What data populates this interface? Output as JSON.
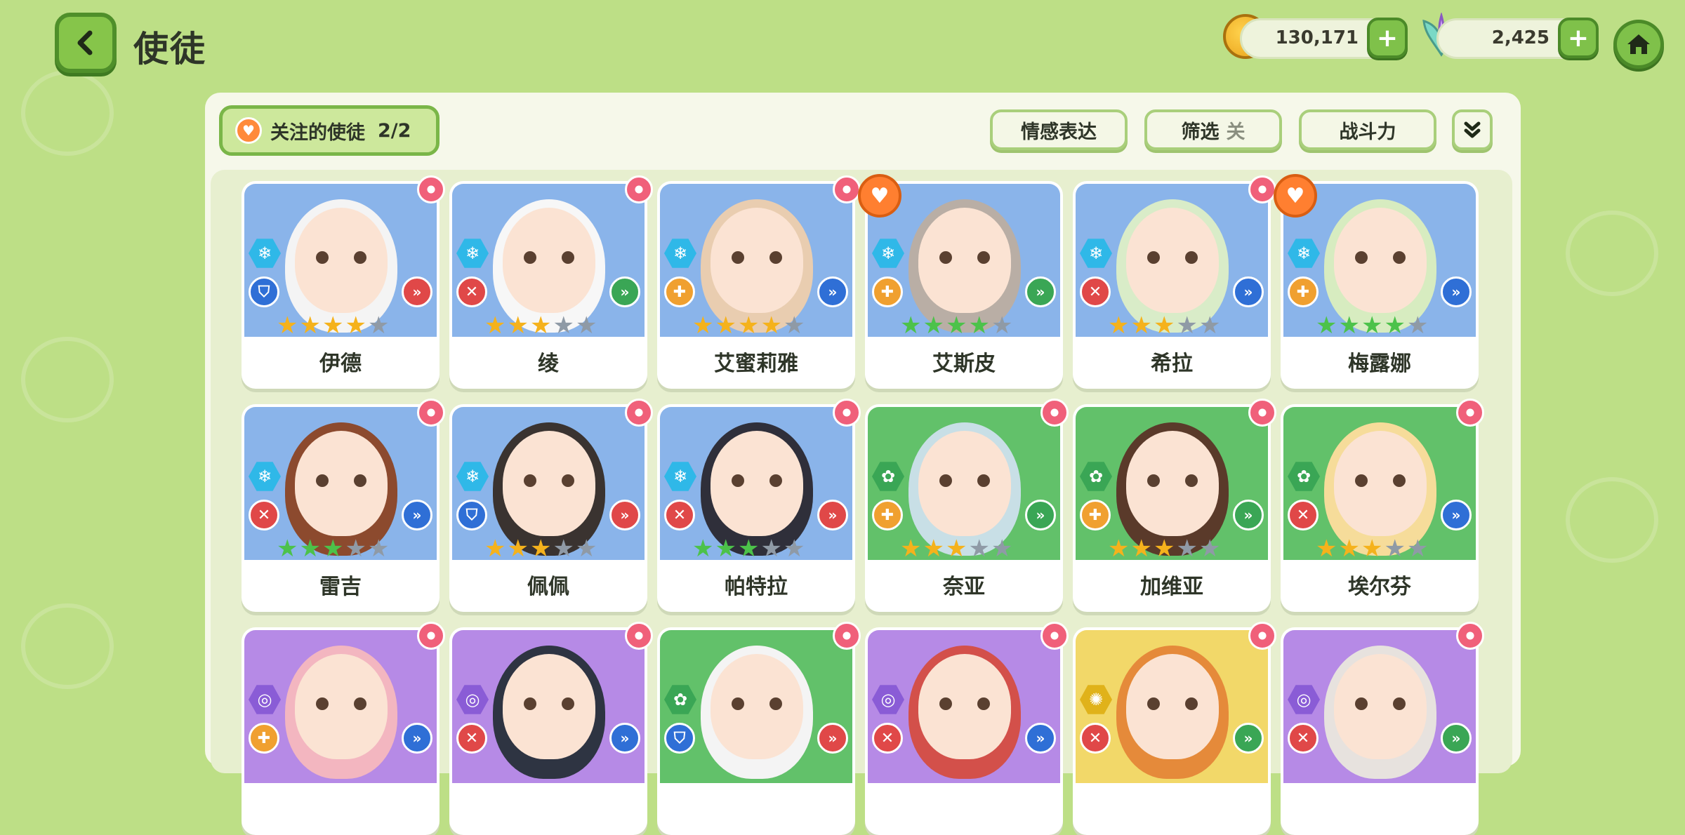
{
  "header": {
    "title": "使徒",
    "gold": "130,171",
    "gems": "2,425"
  },
  "toolbar": {
    "follow_label": "关注的使徒",
    "follow_count": "2/2",
    "emotion_label": "情感表达",
    "filter_label": "筛选",
    "filter_state": "关",
    "power_label": "战斗力"
  },
  "colors": {
    "blue": "#8ab4ea",
    "green": "#62c16a",
    "purple": "#b68ae6",
    "yellow": "#f2d869"
  },
  "cards": [
    {
      "name": "伊德",
      "bg": "#8ab4ea",
      "element": "ice",
      "role": "shield",
      "attack": "red",
      "stars": 4,
      "star_color": "gold",
      "followed": false
    },
    {
      "name": "绫",
      "bg": "#8ab4ea",
      "element": "ice",
      "role": "sword",
      "attack": "green",
      "stars": 3,
      "star_color": "gold",
      "followed": false
    },
    {
      "name": "艾蜜莉雅",
      "bg": "#8ab4ea",
      "element": "ice",
      "role": "heal",
      "attack": "blue",
      "stars": 4,
      "star_color": "gold",
      "followed": false
    },
    {
      "name": "艾斯皮",
      "bg": "#8ab4ea",
      "element": "ice",
      "role": "heal",
      "attack": "green",
      "stars": 4,
      "star_color": "green",
      "followed": true
    },
    {
      "name": "希拉",
      "bg": "#8ab4ea",
      "element": "ice",
      "role": "sword",
      "attack": "blue",
      "stars": 3,
      "star_color": "gold",
      "followed": false
    },
    {
      "name": "梅露娜",
      "bg": "#8ab4ea",
      "element": "ice",
      "role": "heal",
      "attack": "blue",
      "stars": 4,
      "star_color": "green",
      "followed": true
    },
    {
      "name": "雷吉",
      "bg": "#8ab4ea",
      "element": "ice",
      "role": "sword",
      "attack": "blue",
      "stars": 3,
      "star_color": "green",
      "followed": false
    },
    {
      "name": "佩佩",
      "bg": "#8ab4ea",
      "element": "ice",
      "role": "shield",
      "attack": "red",
      "stars": 3,
      "star_color": "gold",
      "followed": false
    },
    {
      "name": "帕特拉",
      "bg": "#8ab4ea",
      "element": "ice",
      "role": "sword",
      "attack": "red",
      "stars": 3,
      "star_color": "green",
      "followed": false
    },
    {
      "name": "奈亚",
      "bg": "#62c16a",
      "element": "nature",
      "role": "heal",
      "attack": "green",
      "stars": 3,
      "star_color": "gold",
      "followed": false
    },
    {
      "name": "加维亚",
      "bg": "#62c16a",
      "element": "nature",
      "role": "heal",
      "attack": "green",
      "stars": 3,
      "star_color": "gold",
      "followed": false
    },
    {
      "name": "埃尔芬",
      "bg": "#62c16a",
      "element": "nature",
      "role": "sword",
      "attack": "blue",
      "stars": 3,
      "star_color": "gold",
      "followed": false
    },
    {
      "name": "",
      "bg": "#b68ae6",
      "element": "dark",
      "role": "heal",
      "attack": "blue",
      "stars": 0,
      "star_color": "gold",
      "followed": false
    },
    {
      "name": "",
      "bg": "#b68ae6",
      "element": "dark",
      "role": "sword",
      "attack": "blue",
      "stars": 0,
      "star_color": "gold",
      "followed": false
    },
    {
      "name": "",
      "bg": "#62c16a",
      "element": "nature",
      "role": "shield",
      "attack": "red",
      "stars": 0,
      "star_color": "gold",
      "followed": false
    },
    {
      "name": "",
      "bg": "#b68ae6",
      "element": "dark",
      "role": "sword",
      "attack": "blue",
      "stars": 0,
      "star_color": "gold",
      "followed": false
    },
    {
      "name": "",
      "bg": "#f2d869",
      "element": "light",
      "role": "sword",
      "attack": "green",
      "stars": 0,
      "star_color": "gold",
      "followed": false
    },
    {
      "name": "",
      "bg": "#b68ae6",
      "element": "dark",
      "role": "sword",
      "attack": "green",
      "stars": 0,
      "star_color": "gold",
      "followed": false
    }
  ]
}
